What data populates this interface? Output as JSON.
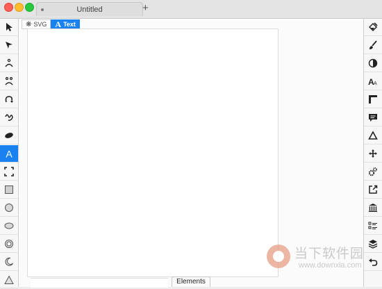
{
  "window": {
    "tab_title": "Untitled",
    "new_tab": "+"
  },
  "mode_bar": {
    "svg_label": "SVG",
    "text_label": "Text",
    "svg_icon": "asterisk-icon",
    "text_icon": "A"
  },
  "left_tools": [
    {
      "name": "select-arrow-icon"
    },
    {
      "name": "direct-select-arrow-icon"
    },
    {
      "name": "node-tool-icon"
    },
    {
      "name": "node-pair-tool-icon"
    },
    {
      "name": "curve-tool-icon"
    },
    {
      "name": "freehand-tool-icon"
    },
    {
      "name": "blob-tool-icon"
    },
    {
      "name": "text-tool-icon",
      "active": true
    },
    {
      "name": "crop-tool-icon"
    },
    {
      "name": "rectangle-tool-icon"
    },
    {
      "name": "circle-tool-icon"
    },
    {
      "name": "ellipse-tool-icon"
    },
    {
      "name": "ring-tool-icon"
    },
    {
      "name": "crescent-tool-icon"
    },
    {
      "name": "triangle-tool-icon"
    }
  ],
  "right_tools": [
    {
      "name": "fill-tool-icon"
    },
    {
      "name": "brush-icon"
    },
    {
      "name": "contrast-icon"
    },
    {
      "name": "font-size-icon"
    },
    {
      "name": "ruler-icon"
    },
    {
      "name": "speech-bubble-icon"
    },
    {
      "name": "triangle-outline-icon"
    },
    {
      "name": "move-icon"
    },
    {
      "name": "settings-gears-icon"
    },
    {
      "name": "export-icon"
    },
    {
      "name": "library-icon"
    },
    {
      "name": "list-icon"
    },
    {
      "name": "layers-icon"
    },
    {
      "name": "undo-icon"
    }
  ],
  "elements_label": "Elements",
  "watermark": {
    "brand": "当下软件园",
    "url": "www.downxia.com"
  },
  "colors": {
    "accent": "#1a82f0"
  }
}
